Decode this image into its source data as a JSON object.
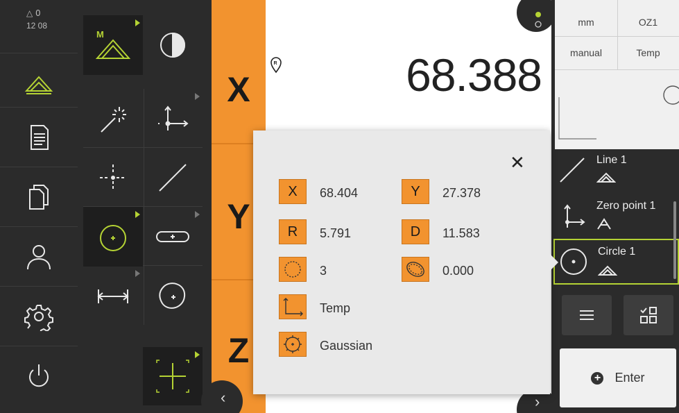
{
  "status": {
    "warning_count": "0",
    "time": "12 08"
  },
  "axes": [
    "X",
    "Y",
    "Z"
  ],
  "readout": {
    "x_value": "68.388"
  },
  "quick_access": {
    "unit": "mm",
    "workpiece_ref": "OZ1",
    "mode": "manual",
    "coord_system": "Temp"
  },
  "features": [
    {
      "name": "Line 1"
    },
    {
      "name": "Zero point 1"
    },
    {
      "name": "Circle 1"
    }
  ],
  "enter_label": "Enter",
  "popup": {
    "rows": [
      {
        "badge": "X",
        "value": "68.404"
      },
      {
        "badge": "Y",
        "value": "27.378"
      },
      {
        "badge": "R",
        "value": "5.791"
      },
      {
        "badge": "D",
        "value": "11.583"
      },
      {
        "badge": "points-icon",
        "value": "3"
      },
      {
        "badge": "form-error-icon",
        "value": "0.000"
      },
      {
        "badge": "coordinate-system-icon",
        "value": "Temp"
      },
      {
        "badge": "fit-algorithm-icon",
        "value": "Gaussian"
      }
    ]
  },
  "colors": {
    "accent_orange": "#f2932f",
    "accent_green": "#b5d334",
    "background": "#2b2b2b"
  }
}
